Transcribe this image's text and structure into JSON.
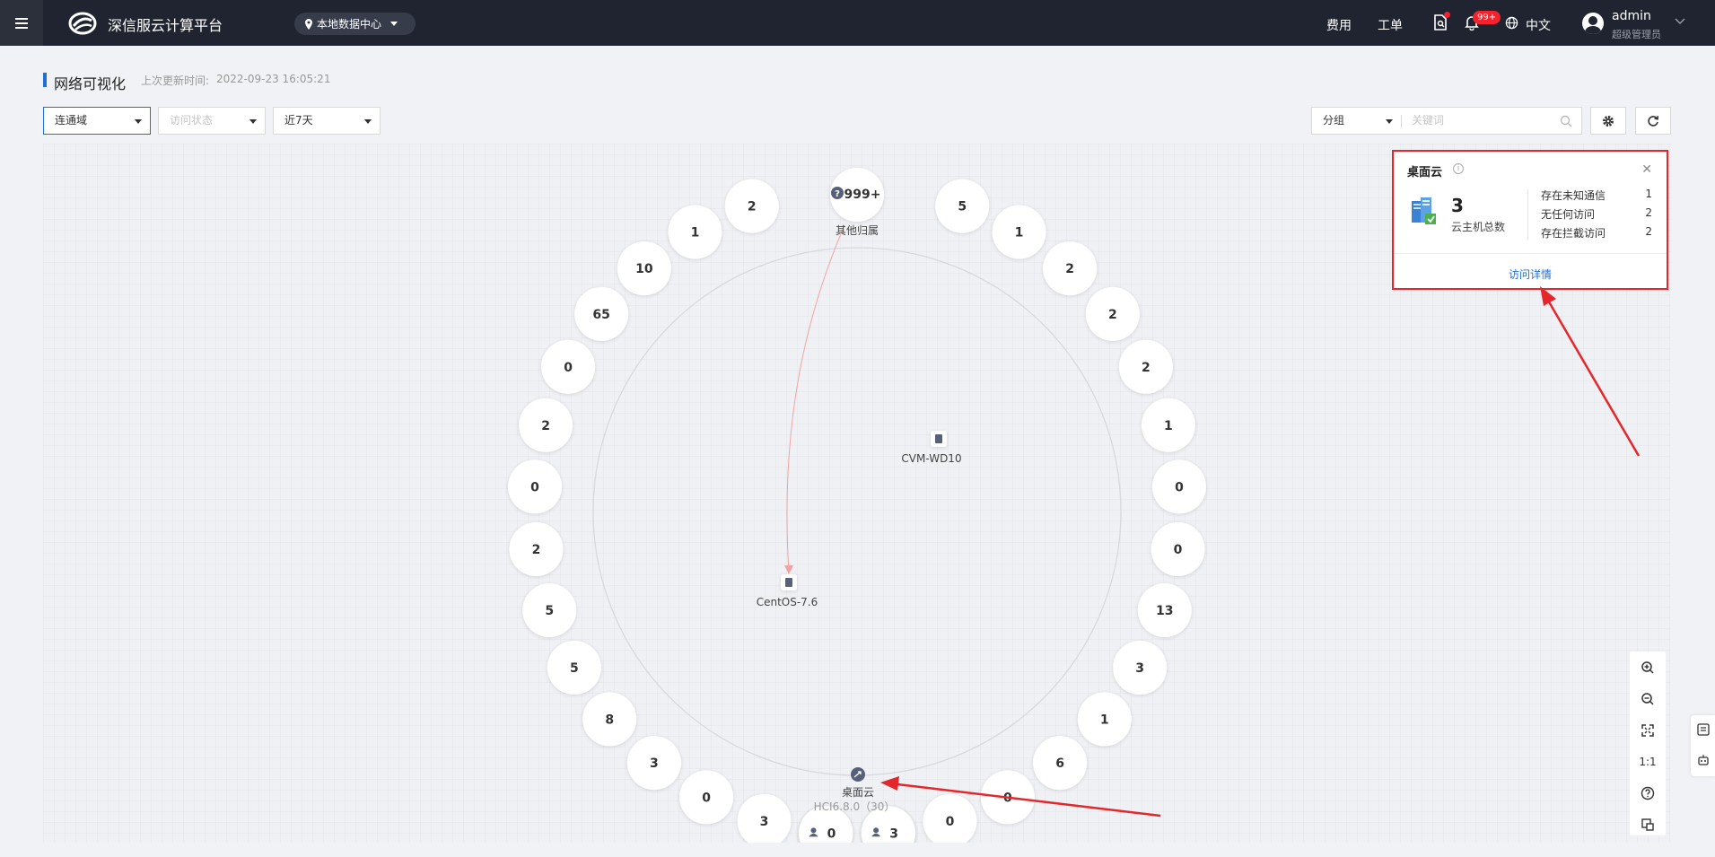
{
  "topbar": {
    "app_title": "深信服云计算平台",
    "datacenter": "本地数据中心",
    "links": {
      "billing": "费用",
      "ticket": "工单"
    },
    "notification_badge": "99+",
    "language": "中文",
    "user_name": "admin",
    "user_role": "超级管理员"
  },
  "header": {
    "page_title": "网络可视化",
    "update_label": "上次更新时间:",
    "update_time": "2022-09-23 16:05:21"
  },
  "filters": {
    "domain": "连通域",
    "access_status": "访问状态",
    "time_range": "近7天",
    "group": "分组",
    "keyword_placeholder": "关键词"
  },
  "graph": {
    "center_top_label": "其他归属",
    "center_top_count": "999+",
    "hub_label": "桌面云",
    "hub_sub": "HCI6.8.0（30）",
    "vm1_label": "CVM-WD10",
    "vm2_label": "CentOS-7.6",
    "left_arc_counts": [
      "2",
      "1",
      "10",
      "65",
      "0",
      "2",
      "0",
      "2",
      "5",
      "5",
      "8",
      "3",
      "0",
      "3",
      "3",
      "0"
    ],
    "right_arc_counts": [
      "5",
      "1",
      "2",
      "2",
      "2",
      "1",
      "0",
      "0",
      "13",
      "3",
      "1",
      "6",
      "0",
      "0",
      "3",
      "0"
    ]
  },
  "popup": {
    "title": "桌面云",
    "count": "3",
    "count_label": "云主机总数",
    "rows": [
      {
        "label": "存在未知通信",
        "value": "1"
      },
      {
        "label": "无任何访问",
        "value": "2"
      },
      {
        "label": "存在拦截访问",
        "value": "2"
      }
    ],
    "link": "访问详情"
  },
  "toolbar": {
    "one_to_one": "1:1"
  },
  "colors": {
    "accent": "#1e6fd9",
    "topbar": "#1f2430",
    "annotation": "#e5262a"
  }
}
